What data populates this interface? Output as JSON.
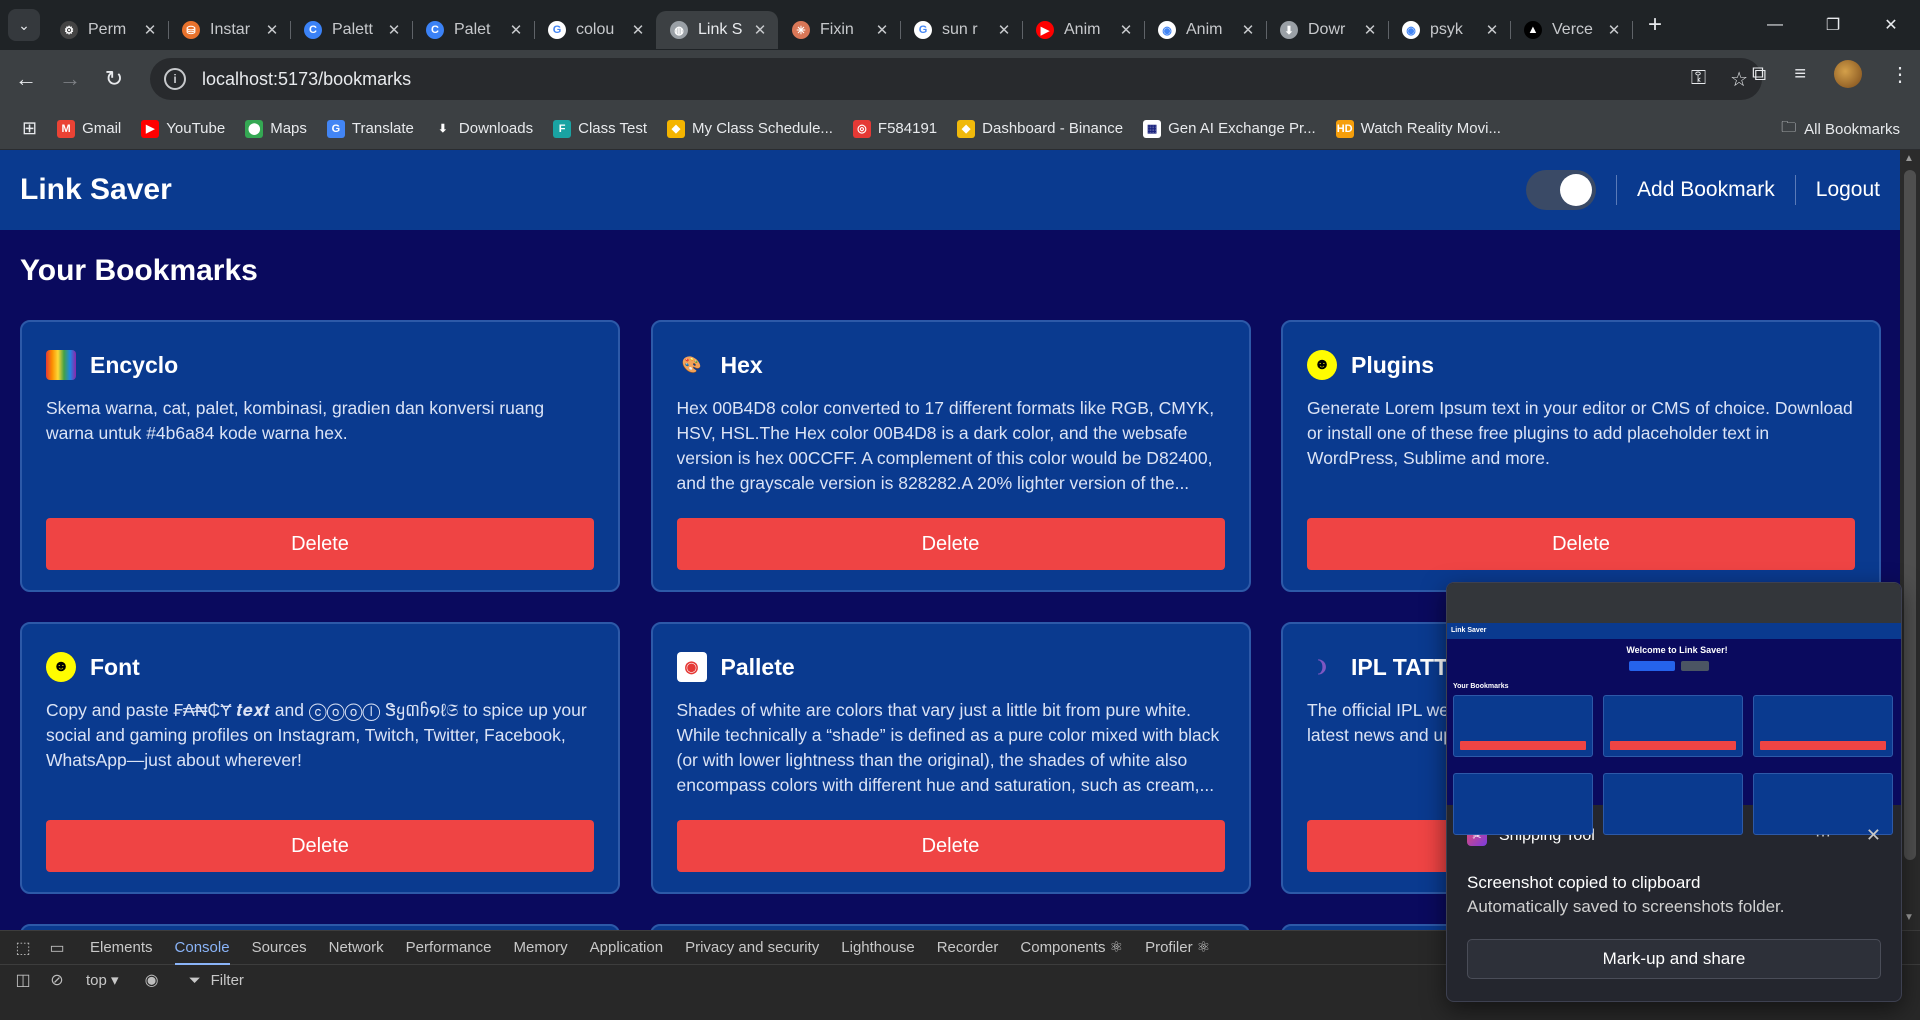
{
  "browser": {
    "tabs": [
      {
        "title": "Perm",
        "icon": "openai-icon",
        "color": "#444",
        "glyph": "⚙"
      },
      {
        "title": "Instar",
        "icon": "instar-icon",
        "color": "#e8722c",
        "glyph": "⛁"
      },
      {
        "title": "Palett",
        "icon": "palette-icon",
        "color": "#3b82f6",
        "glyph": "C"
      },
      {
        "title": "Palet",
        "icon": "palette-icon",
        "color": "#3b82f6",
        "glyph": "C"
      },
      {
        "title": "colou",
        "icon": "google-icon",
        "color": "#ffffff",
        "glyph": "G"
      },
      {
        "title": "Link S",
        "icon": "globe-icon",
        "color": "#9aa0a6",
        "glyph": "◍",
        "active": true
      },
      {
        "title": "Fixin",
        "icon": "claude-icon",
        "color": "#d97757",
        "glyph": "✳"
      },
      {
        "title": "sun r",
        "icon": "google-icon",
        "color": "#ffffff",
        "glyph": "G"
      },
      {
        "title": "Anim",
        "icon": "youtube-icon",
        "color": "#ff0000",
        "glyph": "▶"
      },
      {
        "title": "Anim",
        "icon": "github-icon",
        "color": "#ffffff",
        "glyph": "◉"
      },
      {
        "title": "Dowr",
        "icon": "download-icon",
        "color": "#9aa0a6",
        "glyph": "⬇"
      },
      {
        "title": "psyk",
        "icon": "github-icon",
        "color": "#ffffff",
        "glyph": "◉"
      },
      {
        "title": "Verce",
        "icon": "vercel-icon",
        "color": "#000000",
        "glyph": "▲"
      }
    ],
    "url": "localhost:5173/bookmarks",
    "bookmarks": [
      {
        "label": "Gmail",
        "icon": "gmail-icon",
        "color": "#ea4335",
        "glyph": "M"
      },
      {
        "label": "YouTube",
        "icon": "youtube-icon",
        "color": "#ff0000",
        "glyph": "▶"
      },
      {
        "label": "Maps",
        "icon": "maps-icon",
        "color": "#34a853",
        "glyph": "⬤"
      },
      {
        "label": "Translate",
        "icon": "translate-icon",
        "color": "#4285f4",
        "glyph": "G"
      },
      {
        "label": "Downloads",
        "icon": "download-icon",
        "color": "#3c4043",
        "glyph": "⬇"
      },
      {
        "label": "Class Test",
        "icon": "classtest-icon",
        "color": "#1aa3a3",
        "glyph": "F"
      },
      {
        "label": "My Class Schedule...",
        "icon": "schedule-icon",
        "color": "#f4b400",
        "glyph": "◆"
      },
      {
        "label": "F584191",
        "icon": "record-icon",
        "color": "#e53935",
        "glyph": "◎"
      },
      {
        "label": "Dashboard - Binance",
        "icon": "binance-icon",
        "color": "#f0b90b",
        "glyph": "◆"
      },
      {
        "label": "Gen AI Exchange Pr...",
        "icon": "genai-icon",
        "color": "#ffffff",
        "glyph": "▦"
      },
      {
        "label": "Watch Reality Movi...",
        "icon": "hd-icon",
        "color": "#f59e0b",
        "glyph": "HD"
      }
    ],
    "all_bookmarks": "All Bookmarks"
  },
  "app": {
    "brand": "Link Saver",
    "add_bookmark": "Add Bookmark",
    "logout": "Logout",
    "heading": "Your Bookmarks",
    "delete_label": "Delete",
    "cards": [
      {
        "title": "Encyclo",
        "icon": "rainbow-books-icon",
        "desc": "Skema warna, cat, palet, kombinasi, gradien dan konversi ruang warna untuk #4b6a84 kode warna hex."
      },
      {
        "title": "Hex",
        "icon": "palette-icon",
        "desc": "Hex 00B4D8 color converted to 17 different formats like RGB, CMYK, HSV, HSL.The Hex color 00B4D8 is a dark color, and the websafe version is hex 00CCFF. A complement of this color would be D82400, and the grayscale version is 828282.A 20% lighter version of the..."
      },
      {
        "title": "Plugins",
        "icon": "snapchat-icon",
        "desc": "Generate Lorem Ipsum text in your editor or CMS of choice. Download or install one of these free plugins to add placeholder text in WordPress, Sublime and more."
      },
      {
        "title": "Font",
        "icon": "snapchat-icon",
        "desc": "Copy and paste ₣₳₦₵Ɏ 𝒕𝒆𝒙𝒕 and ⓒⓞⓞⓛ Ꮥყ៣ჩ໑ℓ𝔖 to spice up your social and gaming profiles on Instagram, Twitch, Twitter, Facebook, WhatsApp—just about wherever!"
      },
      {
        "title": "Pallete",
        "icon": "pallete-ring-icon",
        "desc": "Shades of white are colors that vary just a little bit from pure white. While technically a “shade” is defined as a pure color mixed with black (or with lower lightness than the original), the shades of white also encompass colors with different hue and saturation, such as cream,..."
      },
      {
        "title": "IPL TATTA",
        "icon": "ipl-icon",
        "desc": "The official IPL website. Get the latest IPL news, live scores and all the latest news and updates."
      }
    ]
  },
  "devtools": {
    "tabs": [
      "Elements",
      "Console",
      "Sources",
      "Network",
      "Performance",
      "Memory",
      "Application",
      "Privacy and security",
      "Lighthouse",
      "Recorder",
      "Components ⚛",
      "Profiler ⚛"
    ],
    "active_tab": "Console",
    "context": "top ▾",
    "filter": "Filter"
  },
  "snipping_tool": {
    "app_name": "Snipping Tool",
    "title": "Screenshot copied to clipboard",
    "desc": "Automatically saved to screenshots folder.",
    "button": "Mark-up and share",
    "preview_welcome": "Welcome to Link Saver!"
  }
}
